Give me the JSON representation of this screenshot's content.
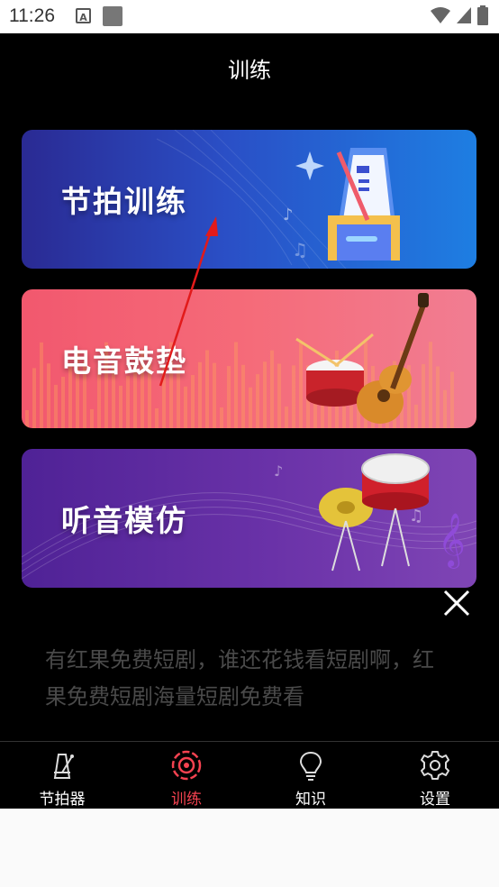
{
  "status_bar": {
    "time": "11:26",
    "notification_letter": "A"
  },
  "header": {
    "title": "训练"
  },
  "cards": [
    {
      "label": "节拍训练"
    },
    {
      "label": "电音鼓垫"
    },
    {
      "label": "听音模仿"
    }
  ],
  "ad": {
    "text": "有红果免费短剧，谁还花钱看短剧啊，红果免费短剧海量短剧免费看"
  },
  "nav": {
    "items": [
      {
        "label": "节拍器",
        "icon": "metronome-icon",
        "active": false
      },
      {
        "label": "训练",
        "icon": "target-icon",
        "active": true
      },
      {
        "label": "知识",
        "icon": "lightbulb-icon",
        "active": false
      },
      {
        "label": "设置",
        "icon": "gear-icon",
        "active": false
      }
    ]
  },
  "colors": {
    "active": "#f44250",
    "background": "#000000"
  }
}
